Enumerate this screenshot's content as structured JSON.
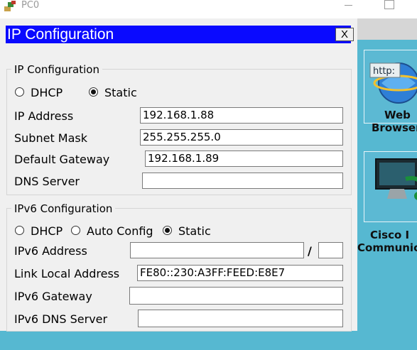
{
  "window": {
    "title": "PC0"
  },
  "dialog": {
    "title": "IP Configuration",
    "close_label": "X",
    "ipv4": {
      "legend": "IP Configuration",
      "dhcp_label": "DHCP",
      "static_label": "Static",
      "mode": "Static",
      "ip_address_label": "IP Address",
      "ip_address": "192.168.1.88",
      "subnet_label": "Subnet Mask",
      "subnet": "255.255.255.0",
      "gateway_label": "Default Gateway",
      "gateway": "192.168.1.89",
      "dns_label": "DNS Server",
      "dns": ""
    },
    "ipv6": {
      "legend": "IPv6 Configuration",
      "dhcp_label": "DHCP",
      "auto_label": "Auto Config",
      "static_label": "Static",
      "mode": "Static",
      "address_label": "IPv6 Address",
      "address": "",
      "slash": "/",
      "prefix": "",
      "link_local_label": "Link Local Address",
      "link_local": "FE80::230:A3FF:FEED:E8E7",
      "gateway_label": "IPv6 Gateway",
      "gateway": "",
      "dns_label": "IPv6 DNS Server",
      "dns": ""
    }
  },
  "desktop": {
    "tiles": [
      {
        "line1": "Web",
        "line2": "Browser",
        "icon": "web-browser-icon",
        "icon_text": "http:"
      },
      {
        "line1": "Cisco I",
        "line2": "Communic",
        "icon": "cisco-ip-communicator-icon"
      }
    ]
  },
  "colors": {
    "dialog_titlebar": "#0a0aff",
    "desktop": "#56b8d1"
  }
}
